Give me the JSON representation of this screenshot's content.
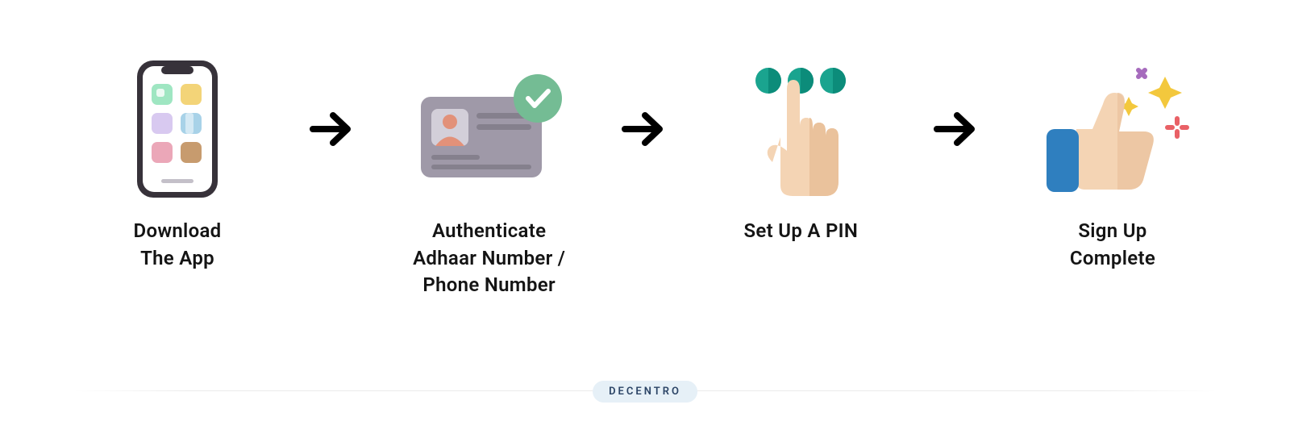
{
  "brand": "DECENTRO",
  "steps": [
    {
      "label": "Download\nThe App",
      "icon": "phone-apps-icon"
    },
    {
      "label": "Authenticate\nAdhaar Number /\nPhone Number",
      "icon": "id-card-check-icon"
    },
    {
      "label": "Set Up A PIN",
      "icon": "hand-pin-icon"
    },
    {
      "label": "Sign Up\nComplete",
      "icon": "thumbs-up-sparkle-icon"
    }
  ],
  "colors": {
    "arrow": "#000000",
    "phone_body": "#37323a",
    "card_body": "#9f99a8",
    "card_face": "#e29179",
    "green": "#74bc94",
    "teal": "#1aa48f",
    "skin": "#f4d4b4",
    "cuff": "#2f7fbf",
    "yellow": "#f3c83d",
    "purple": "#a66bbd",
    "red": "#e96166"
  }
}
